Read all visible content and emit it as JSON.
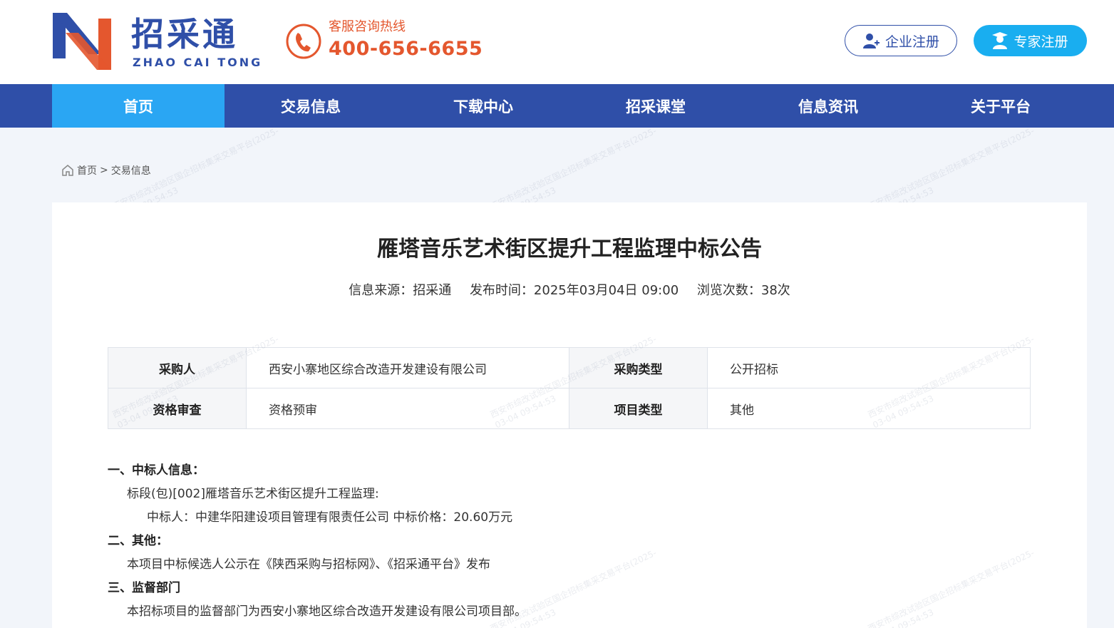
{
  "header": {
    "logo_text": "招采通",
    "logo_sub": "ZHAO CAI TONG",
    "hotline_label": "客服咨询热线",
    "hotline_number": "400-656-6655",
    "enterprise_register": "企业注册",
    "expert_register": "专家注册"
  },
  "colors": {
    "brand_blue": "#2f4fa8",
    "accent_orange": "#e4572e",
    "nav_active": "#2aa6f3",
    "expert_button": "#19aef0"
  },
  "nav": {
    "items": [
      {
        "label": "首页",
        "active": true
      },
      {
        "label": "交易信息",
        "active": false
      },
      {
        "label": "下载中心",
        "active": false
      },
      {
        "label": "招采课堂",
        "active": false
      },
      {
        "label": "信息资讯",
        "active": false
      },
      {
        "label": "关于平台",
        "active": false
      }
    ]
  },
  "breadcrumb": {
    "home": "首页",
    "separator": ">",
    "current": "交易信息"
  },
  "article": {
    "title": "雁塔音乐艺术街区提升工程监理中标公告",
    "source": "信息来源：招采通",
    "publish_time": "发布时间：2025年03月04日 09:00",
    "views": "浏览次数：38次",
    "info_table": [
      {
        "k1": "采购人",
        "v1": "西安小寨地区综合改造开发建设有限公司",
        "k2": "采购类型",
        "v2": "公开招标"
      },
      {
        "k1": "资格审查",
        "v1": "资格预审",
        "k2": "项目类型",
        "v2": "其他"
      }
    ],
    "sections": {
      "s1_title": "一、中标人信息：",
      "s1_lot": "标段(包)[002]雁塔音乐艺术街区提升工程监理:",
      "s1_winner": "中标人：中建华阳建设项目管理有限责任公司 中标价格：20.60万元",
      "s2_title": "二、其他：",
      "s2_text": "本项目中标候选人公示在《陕西采购与招标网》、《招采通平台》发布",
      "s3_title": "三、监督部门",
      "s3_text": "本招标项目的监督部门为西安小寨地区综合改造开发建设有限公司项目部。"
    }
  },
  "watermark": {
    "line1": "西安市综改试验区国企招标集采交易平台(2025-",
    "line2": "03-04 09:54:53"
  }
}
